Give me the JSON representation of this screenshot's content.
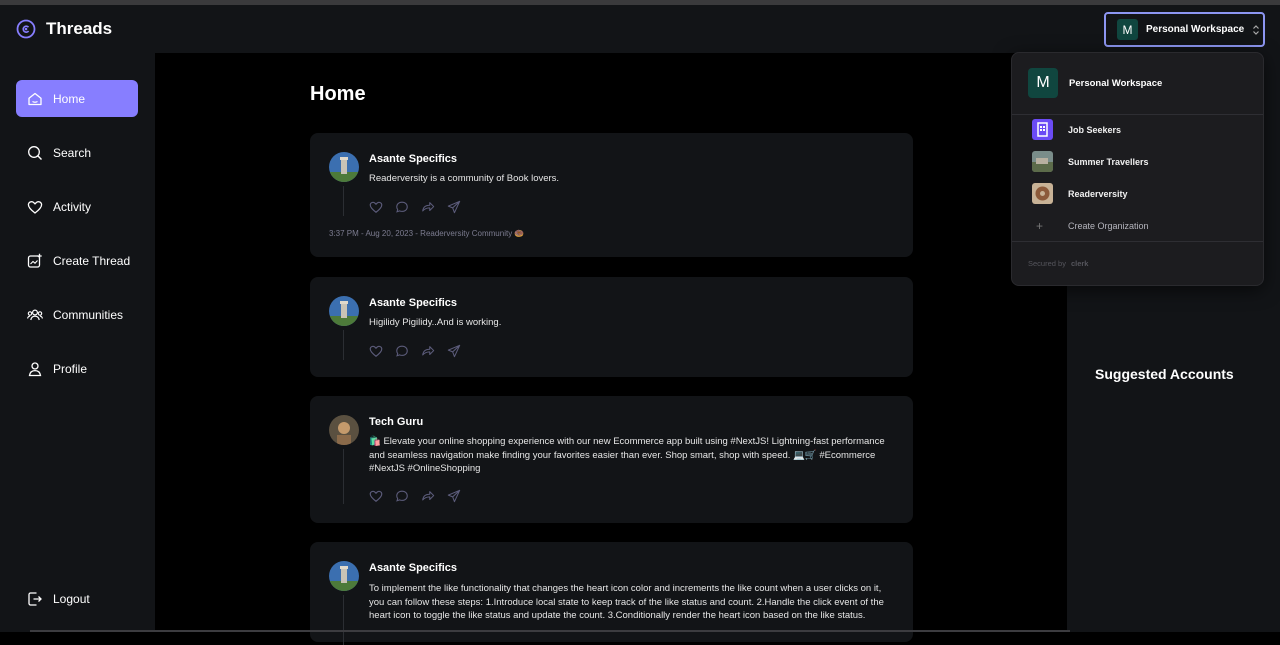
{
  "app": {
    "name": "Threads"
  },
  "workspace": {
    "avatar_letter": "M",
    "name": "Personal Workspace"
  },
  "sidebar": {
    "items": [
      {
        "label": "Home",
        "icon": "home-icon",
        "active": true
      },
      {
        "label": "Search",
        "icon": "search-icon"
      },
      {
        "label": "Activity",
        "icon": "heart-icon"
      },
      {
        "label": "Create Thread",
        "icon": "create-icon"
      },
      {
        "label": "Communities",
        "icon": "users-icon"
      },
      {
        "label": "Profile",
        "icon": "user-icon"
      }
    ],
    "logout": "Logout"
  },
  "main": {
    "title": "Home",
    "threads": [
      {
        "author": "Asante Specifics",
        "text": "Readerversity is a community of Book lovers.",
        "meta": "3:37 PM - Aug 20, 2023 - Readerversity Community 🍩"
      },
      {
        "author": "Asante Specifics",
        "text": "Higilidy Pigilidy..And is working."
      },
      {
        "author": "Tech Guru",
        "text": "🛍️ Elevate your online shopping experience with our new Ecommerce app built using #NextJS! Lightning-fast performance and seamless navigation make finding your favorites easier than ever. Shop smart, shop with speed. 💻🛒 #Ecommerce #NextJS #OnlineShopping"
      },
      {
        "author": "Asante Specifics",
        "text": "To implement the like functionality that changes the heart icon color and increments the like count when a user clicks on it, you can follow these steps: 1.Introduce local state to keep track of the like status and count. 2.Handle the click event of the heart icon to toggle the like status and update the count. 3.Conditionally render the heart icon based on the like status."
      }
    ]
  },
  "rightbar": {
    "suggested_title": "Suggested Accounts"
  },
  "dropdown": {
    "current": {
      "avatar_letter": "M",
      "name": "Personal Workspace"
    },
    "organizations": [
      {
        "name": "Job Seekers"
      },
      {
        "name": "Summer Travellers"
      },
      {
        "name": "Readerversity"
      }
    ],
    "create_label": "Create Organization",
    "secured_label": "Secured by",
    "clerk_label": "clerk"
  },
  "colors": {
    "accent": "#877eff",
    "sidebar_bg": "#121417",
    "card_bg": "#121417",
    "workspace_green": "#10463f"
  }
}
